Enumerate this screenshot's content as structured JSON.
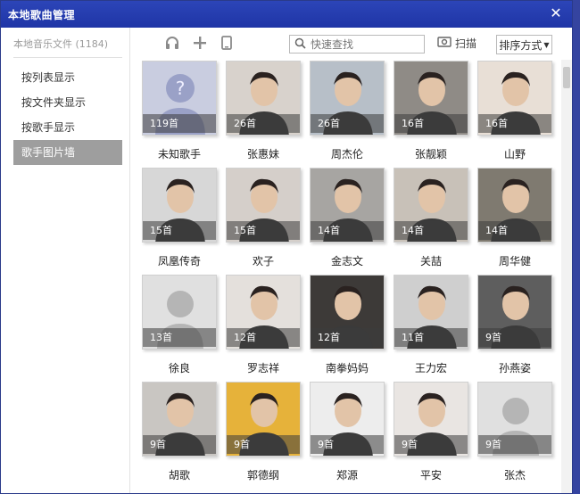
{
  "window": {
    "title": "本地歌曲管理"
  },
  "sidebar": {
    "header": "本地音乐文件 (1184)",
    "items": [
      {
        "label": "按列表显示",
        "active": false
      },
      {
        "label": "按文件夹显示",
        "active": false
      },
      {
        "label": "按歌手显示",
        "active": false
      },
      {
        "label": "歌手图片墙",
        "active": true
      }
    ]
  },
  "toolbar": {
    "icons": [
      "headphones-icon",
      "add-icon",
      "device-icon"
    ],
    "search_placeholder": "快速查找",
    "scan_label": "扫描",
    "sort_label": "排序方式"
  },
  "artists": [
    {
      "name": "未知歌手",
      "count": "119首",
      "photo": "unknown",
      "bg": "#c9cde0"
    },
    {
      "name": "张惠妹",
      "count": "26首",
      "photo": "person",
      "bg": "#d8d2cc"
    },
    {
      "name": "周杰伦",
      "count": "26首",
      "photo": "person",
      "bg": "#b7bfc8"
    },
    {
      "name": "张靓颖",
      "count": "16首",
      "photo": "person",
      "bg": "#8f8b86"
    },
    {
      "name": "山野",
      "count": "16首",
      "photo": "person",
      "bg": "#e8dfd6"
    },
    {
      "name": "凤凰传奇",
      "count": "15首",
      "photo": "person",
      "bg": "#d7d7d7"
    },
    {
      "name": "欢子",
      "count": "15首",
      "photo": "person",
      "bg": "#d5cfca"
    },
    {
      "name": "金志文",
      "count": "14首",
      "photo": "person",
      "bg": "#a7a5a2"
    },
    {
      "name": "关喆",
      "count": "14首",
      "photo": "person",
      "bg": "#c8c1b8"
    },
    {
      "name": "周华健",
      "count": "14首",
      "photo": "person",
      "bg": "#7f7a70"
    },
    {
      "name": "徐良",
      "count": "13首",
      "photo": "silhouette",
      "bg": "#e0e0e0"
    },
    {
      "name": "罗志祥",
      "count": "12首",
      "photo": "person",
      "bg": "#e4e0dc"
    },
    {
      "name": "南拳妈妈",
      "count": "12首",
      "photo": "person",
      "bg": "#3d3a38"
    },
    {
      "name": "王力宏",
      "count": "11首",
      "photo": "person",
      "bg": "#cfcfcf"
    },
    {
      "name": "孙燕姿",
      "count": "9首",
      "photo": "person",
      "bg": "#5e5e5e"
    },
    {
      "name": "胡歌",
      "count": "9首",
      "photo": "person",
      "bg": "#c9c6c2"
    },
    {
      "name": "郭德纲",
      "count": "9首",
      "photo": "person",
      "bg": "#e6b23a"
    },
    {
      "name": "郑源",
      "count": "9首",
      "photo": "person",
      "bg": "#ededed"
    },
    {
      "name": "平安",
      "count": "9首",
      "photo": "person",
      "bg": "#e9e5e2"
    },
    {
      "name": "张杰",
      "count": "9首",
      "photo": "silhouette",
      "bg": "#e0e0e0"
    }
  ]
}
